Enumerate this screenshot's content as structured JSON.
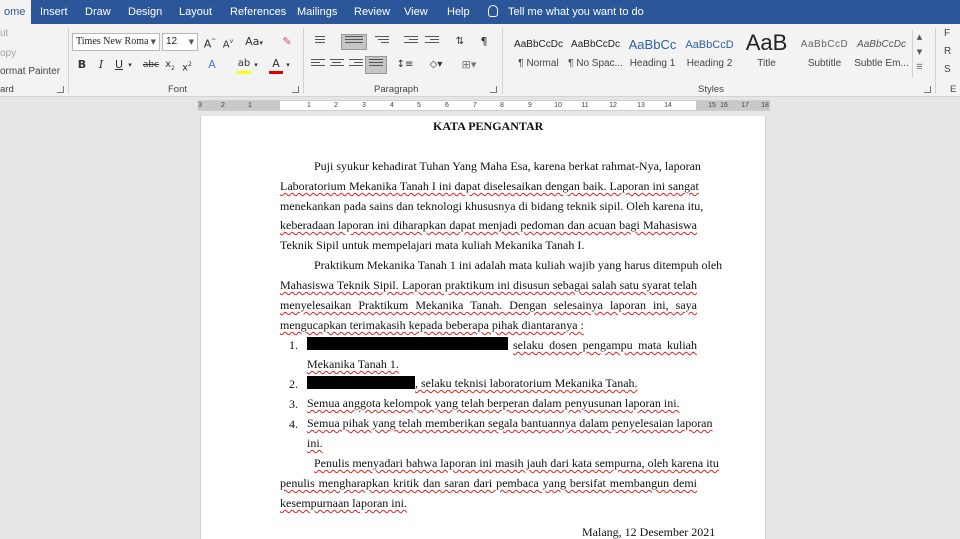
{
  "tabs": [
    "ome",
    "Insert",
    "Draw",
    "Design",
    "Layout",
    "References",
    "Mailings",
    "Review",
    "View",
    "Help"
  ],
  "tell_me": "Tell me what you want to do",
  "clipboard": {
    "cut": "ut",
    "copy": "opy",
    "format_painter": "ormat Painter",
    "label": "ard"
  },
  "font": {
    "name": "Times New Roma",
    "size": "12",
    "label": "Font"
  },
  "paragraph": {
    "label": "Paragraph"
  },
  "styles": {
    "label": "Styles",
    "items": [
      {
        "sample": "AaBbCcDc",
        "name": "¶ Normal"
      },
      {
        "sample": "AaBbCcDc",
        "name": "¶ No Spac..."
      },
      {
        "sample": "AaBbCc",
        "name": "Heading 1"
      },
      {
        "sample": "AaBbCcD",
        "name": "Heading 2"
      },
      {
        "sample": "AaB",
        "name": "Title"
      },
      {
        "sample": "AaBbCcD",
        "name": "Subtitle"
      },
      {
        "sample": "AaBbCcDc",
        "name": "Subtle Em..."
      }
    ]
  },
  "editing": {
    "find": "F",
    "replace": "R",
    "select": "S",
    "label": "E"
  },
  "ruler": [
    "3",
    "2",
    "1",
    "1",
    "2",
    "3",
    "4",
    "5",
    "6",
    "7",
    "8",
    "9",
    "10",
    "11",
    "12",
    "13",
    "14",
    "15",
    "16",
    "17",
    "18"
  ],
  "document": {
    "title": "KATA PENGANTAR",
    "p1": [
      "Puji syukur kehadirat Tuhan Yang Maha Esa, karena berkat rahmat-Nya, laporan",
      "Laboratorium Mekanika Tanah I ini dapat diselesaikan dengan baik. Laporan ini sangat",
      "menekankan pada sains dan teknologi khususnya di bidang teknik sipil. Oleh karena itu,",
      "keberadaan laporan ini diharapkan dapat menjadi pedoman dan acuan bagi Mahasiswa",
      "Teknik Sipil untuk mempelajari mata kuliah Mekanika Tanah I."
    ],
    "p2": [
      "Praktikum Mekanika Tanah 1 ini adalah mata kuliah wajib yang harus ditempuh oleh",
      "Mahasiswa Teknik Sipil. Laporan praktikum ini disusun sebagai salah satu syarat telah",
      "menyelesaikan Praktikum Mekanika Tanah. Dengan selesainya laporan ini, saya",
      "mengucapkan terimakasih kepada beberapa pihak diantaranya :"
    ],
    "list": [
      {
        "num": "1.",
        "line1": "selaku dosen pengampu mata kuliah",
        "line2": "Mekanika Tanah 1."
      },
      {
        "num": "2.",
        "line1": ", selaku teknisi laboratorium Mekanika Tanah."
      },
      {
        "num": "3.",
        "line1": "Semua anggota kelompok yang telah berperan dalam penyusunan laporan ini."
      },
      {
        "num": "4.",
        "line1": "Semua pihak yang telah memberikan segala bantuannya dalam penyelesaian laporan",
        "line2": "ini."
      }
    ],
    "p3": [
      "Penulis menyadari bahwa laporan ini masih jauh dari kata sempurna, oleh karena itu",
      "penulis mengharapkan kritik dan saran dari pembaca yang bersifat membangun demi",
      "kesempurnaan laporan ini."
    ],
    "closing": "Malang, 12 Desember 2021"
  },
  "colors": {
    "tabbar": "#2b579a",
    "ribbon": "#f3f3f3",
    "highlight": "#ffff00",
    "font_color": "#e00000",
    "squiggle": "#e02020"
  }
}
